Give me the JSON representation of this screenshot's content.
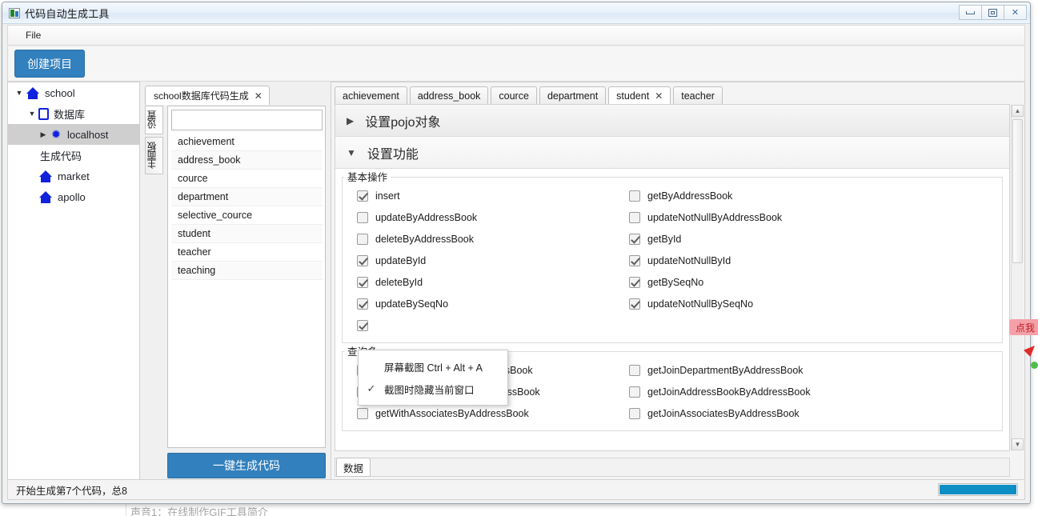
{
  "window": {
    "title": "代码自动生成工具",
    "minimize_label": "最小化",
    "maximize_label": "最大化",
    "close_label": "✕"
  },
  "menubar": {
    "items": [
      "File"
    ]
  },
  "toolbar": {
    "create_project_label": "创建项目"
  },
  "tree": {
    "nodes": [
      {
        "label": "school",
        "icon": "home-icon",
        "arrow": "▼",
        "indent": 1,
        "selected": false
      },
      {
        "label": "数据库",
        "icon": "database-icon",
        "arrow": "▼",
        "indent": 2,
        "selected": false
      },
      {
        "label": "localhost",
        "icon": "connection-icon",
        "arrow": "▶",
        "indent": 3,
        "selected": true
      },
      {
        "label": "生成代码",
        "icon": "none",
        "arrow": "",
        "indent": 3,
        "selected": false
      },
      {
        "label": "market",
        "icon": "home-icon",
        "arrow": "",
        "indent": 2,
        "selected": false
      },
      {
        "label": "apollo",
        "icon": "home-icon",
        "arrow": "",
        "indent": 2,
        "selected": false
      }
    ]
  },
  "mid_panel": {
    "tab_label": "school数据库代码生成",
    "tab_close": "✕",
    "side_tabs": [
      {
        "label": "设置",
        "active": true
      },
      {
        "label": "主面板",
        "active": false
      }
    ],
    "filter_value": "",
    "filter_placeholder": "",
    "tables": [
      "achievement",
      "address_book",
      "cource",
      "department",
      "selective_cource",
      "student",
      "teacher",
      "teaching"
    ],
    "generate_button_label": "一键生成代码"
  },
  "main_panel": {
    "tabs": [
      {
        "label": "achievement",
        "active": false,
        "closable": false
      },
      {
        "label": "address_book",
        "active": false,
        "closable": false
      },
      {
        "label": "cource",
        "active": false,
        "closable": false
      },
      {
        "label": "department",
        "active": false,
        "closable": false
      },
      {
        "label": "student",
        "active": true,
        "closable": true
      },
      {
        "label": "teacher",
        "active": false,
        "closable": false
      }
    ],
    "tab_close_glyph": "✕",
    "sections": [
      {
        "title": "设置pojo对象",
        "expanded": false,
        "arrow": "▶"
      },
      {
        "title": "设置功能",
        "expanded": true,
        "arrow": "▼"
      }
    ],
    "group_basic": {
      "title": "基本操作",
      "left_items": [
        {
          "label": "insert",
          "checked": true
        },
        {
          "label": "updateByAddressBook",
          "checked": false
        },
        {
          "label": "deleteByAddressBook",
          "checked": false
        },
        {
          "label": "updateById",
          "checked": true
        },
        {
          "label": "deleteById",
          "checked": true
        },
        {
          "label": "updateBySeqNo",
          "checked": true
        },
        {
          "label": "",
          "checked": true
        }
      ],
      "right_items": [
        {
          "label": "getByAddressBook",
          "checked": false
        },
        {
          "label": "updateNotNullByAddressBook",
          "checked": false
        },
        {
          "label": "getById",
          "checked": true
        },
        {
          "label": "updateNotNullById",
          "checked": true
        },
        {
          "label": "getBySeqNo",
          "checked": true
        },
        {
          "label": "updateNotNullBySeqNo",
          "checked": true
        },
        {
          "label": "",
          "checked": false
        }
      ]
    },
    "group_query": {
      "title": "查询多",
      "left_items": [
        {
          "label": "getWithDepartmentByAddressBook",
          "checked": false
        },
        {
          "label": "getWithAddressBookByAddressBook",
          "checked": false
        },
        {
          "label": "getWithAssociatesByAddressBook",
          "checked": false
        }
      ],
      "right_items": [
        {
          "label": "getJoinDepartmentByAddressBook",
          "checked": false
        },
        {
          "label": "getJoinAddressBookByAddressBook",
          "checked": false
        },
        {
          "label": "getJoinAssociatesByAddressBook",
          "checked": false
        }
      ]
    },
    "bottom_tab_label": "数据"
  },
  "popup_menu": {
    "items": [
      {
        "label": "屏幕截图 Ctrl + Alt + A",
        "checked": false
      },
      {
        "label": "截图时隐藏当前窗口",
        "checked": true
      }
    ],
    "check_glyph": "✓"
  },
  "statusbar": {
    "text": "开始生成第7个代码，总8",
    "progress_percent": 100
  },
  "float_widget": {
    "badge_text": "点我",
    "pin_name": "red-pin",
    "dot_name": "green-dot"
  },
  "background": {
    "text": "声音1：在线制作GIF工具简介"
  },
  "colors": {
    "accent_blue": "#3280bd",
    "progress_blue": "#0d8ec4",
    "tree_icon_blue": "#1122dd",
    "badge_red": "#c11b25",
    "selection_gray": "#cfcfcf"
  }
}
